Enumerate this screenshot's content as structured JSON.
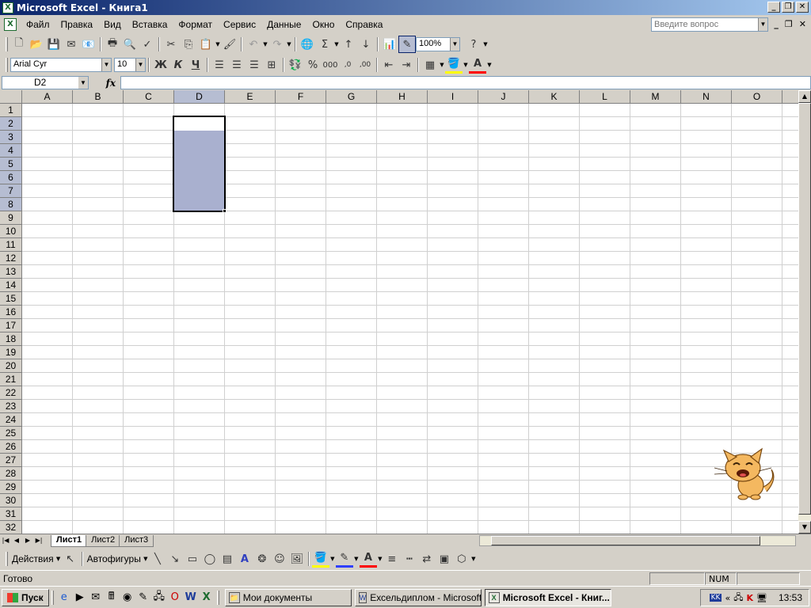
{
  "window": {
    "title": "Microsoft Excel - Книга1"
  },
  "menu": {
    "items": [
      "Файл",
      "Правка",
      "Вид",
      "Вставка",
      "Формат",
      "Сервис",
      "Данные",
      "Окно",
      "Справка"
    ],
    "help_placeholder": "Введите вопрос"
  },
  "toolbar": {
    "zoom": "100%",
    "font_name": "Arial Cyr",
    "font_size": "10",
    "thousands_label": "000"
  },
  "formula_bar": {
    "name_box": "D2",
    "fx_label": "fx",
    "content": ""
  },
  "grid": {
    "columns": [
      "A",
      "B",
      "C",
      "D",
      "E",
      "F",
      "G",
      "H",
      "I",
      "J",
      "K",
      "L",
      "M",
      "N",
      "O"
    ],
    "rows": [
      "1",
      "2",
      "3",
      "4",
      "5",
      "6",
      "7",
      "8",
      "9",
      "10",
      "11",
      "12",
      "13",
      "14",
      "15",
      "16",
      "17",
      "18",
      "19",
      "20",
      "21",
      "22",
      "23",
      "24",
      "25",
      "26",
      "27",
      "28",
      "29",
      "30",
      "31",
      "32"
    ],
    "selected_column": "D",
    "selected_rows": [
      "2",
      "3",
      "4",
      "5",
      "6",
      "7",
      "8"
    ],
    "active_cell": "D2",
    "selection_range": "D2:D8"
  },
  "sheets": {
    "tabs": [
      "Лист1",
      "Лист2",
      "Лист3"
    ],
    "active": "Лист1"
  },
  "drawing": {
    "actions_label": "Действия",
    "autoshapes_label": "Автофигуры"
  },
  "status": {
    "text": "Готово",
    "num": "NUM"
  },
  "taskbar": {
    "start_label": "Пуск",
    "tasks": [
      "Мои документы",
      "Ехсельдиплом - Microsoft...",
      "Microsoft Excel - Книг..."
    ],
    "active_task": 2,
    "clock": "13:53",
    "lang": "KK"
  },
  "colors": {
    "title_start": "#0a246a",
    "title_end": "#a6caf0",
    "selection": "#a9b0cf",
    "header_selected": "#b6bdd2",
    "chrome": "#d4d0c8"
  }
}
